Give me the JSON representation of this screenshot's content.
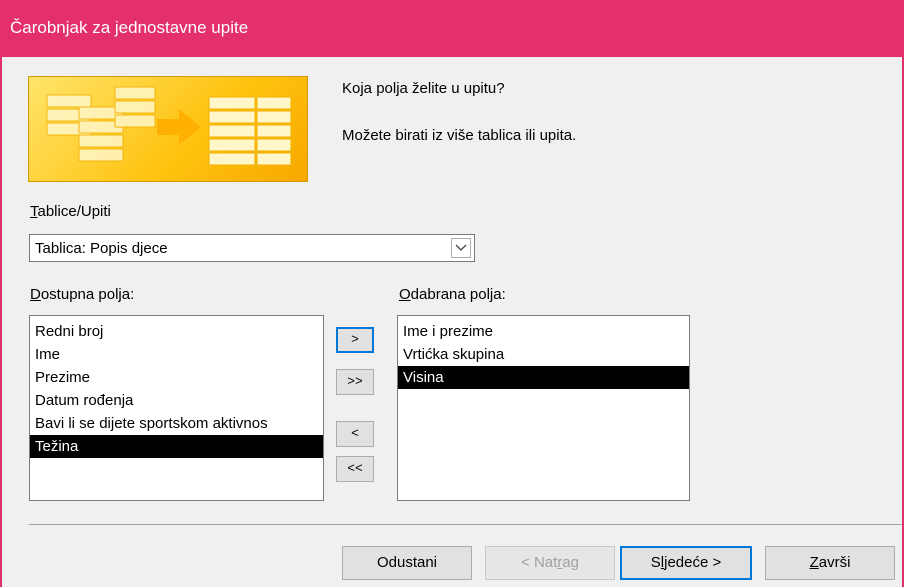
{
  "window": {
    "title": "Čarobnjak za jednostavne upite"
  },
  "intro": {
    "question": "Koja polja želite u upitu?",
    "hint": "Možete birati iz više tablica ili upita."
  },
  "tables": {
    "label_pre": "",
    "label_key": "T",
    "label_post": "ablice/Upiti",
    "selected": "Tablica: Popis djece"
  },
  "available": {
    "label_key": "D",
    "label_post": "ostupna polja:",
    "items": [
      "Redni broj",
      "Ime",
      "Prezime",
      "Datum rođenja",
      "Bavi li se dijete sportskom aktivnos",
      "Težina"
    ],
    "selected_index": 5
  },
  "selected_fields": {
    "label_key": "O",
    "label_post": "dabrana polja:",
    "items": [
      "Ime i prezime",
      "Vrtićka skupina",
      "Visina"
    ],
    "selected_index": 2
  },
  "move_buttons": {
    "add_one": ">",
    "add_all": ">>",
    "remove_one": "<",
    "remove_all": "<<"
  },
  "footer": {
    "cancel": "Odustani",
    "back_pre": "< Nat",
    "back_key": "r",
    "back_post": "ag",
    "next_pre": "S",
    "next_key": "l",
    "next_post": "jedeće >",
    "finish_key": "Z",
    "finish_post": "avrši"
  }
}
